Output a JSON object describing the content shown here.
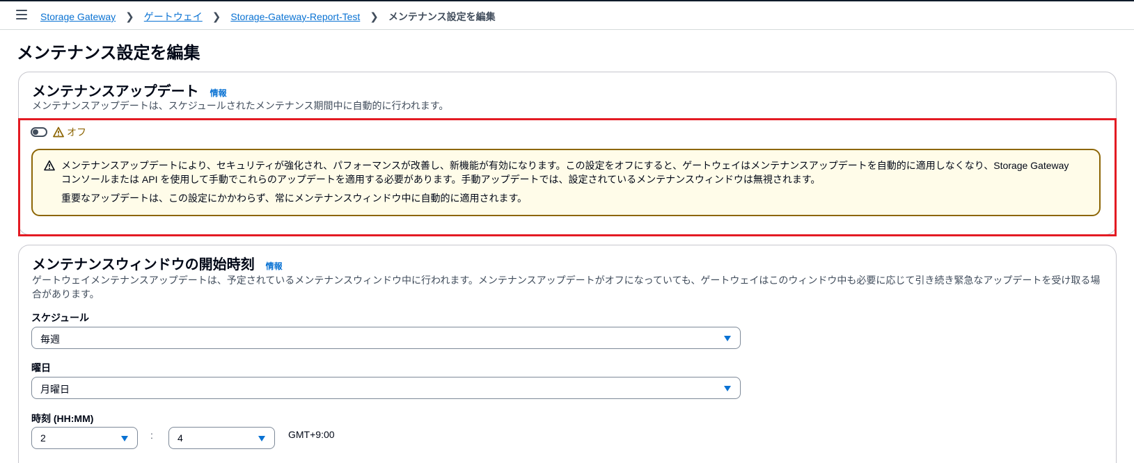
{
  "breadcrumbs": {
    "items": [
      "Storage Gateway",
      "ゲートウェイ",
      "Storage-Gateway-Report-Test"
    ],
    "current": "メンテナンス設定を編集"
  },
  "page_title": "メンテナンス設定を編集",
  "maintenance_updates": {
    "title": "メンテナンスアップデート",
    "info": "情報",
    "description": "メンテナンスアップデートは、スケジュールされたメンテナンス期間中に自動的に行われます。",
    "toggle_state": "オフ",
    "toggle_on": false,
    "alert": {
      "paragraph1": "メンテナンスアップデートにより、セキュリティが強化され、パフォーマンスが改善し、新機能が有効になります。この設定をオフにすると、ゲートウェイはメンテナンスアップデートを自動的に適用しなくなり、Storage Gateway コンソールまたは API を使用して手動でこれらのアップデートを適用する必要があります。手動アップデートでは、設定されているメンテナンスウィンドウは無視されます。",
      "paragraph2": "重要なアップデートは、この設定にかかわらず、常にメンテナンスウィンドウ中に自動的に適用されます。"
    }
  },
  "maintenance_window": {
    "title": "メンテナンスウィンドウの開始時刻",
    "info": "情報",
    "description": "ゲートウェイメンテナンスアップデートは、予定されているメンテナンスウィンドウ中に行われます。メンテナンスアップデートがオフになっていても、ゲートウェイはこのウィンドウ中も必要に応じて引き続き緊急なアップデートを受け取る場合があります。",
    "schedule_label": "スケジュール",
    "schedule_value": "毎週",
    "day_label": "曜日",
    "day_value": "月曜日",
    "time_label": "時刻 (HH:MM)",
    "hour_value": "2",
    "minute_value": "4",
    "time_separator": ":",
    "timezone": "GMT+9:00"
  },
  "colors": {
    "link": "#0972d3",
    "warning": "#8d6605",
    "alert_bg": "#fffce9",
    "highlight": "#e31b23"
  }
}
